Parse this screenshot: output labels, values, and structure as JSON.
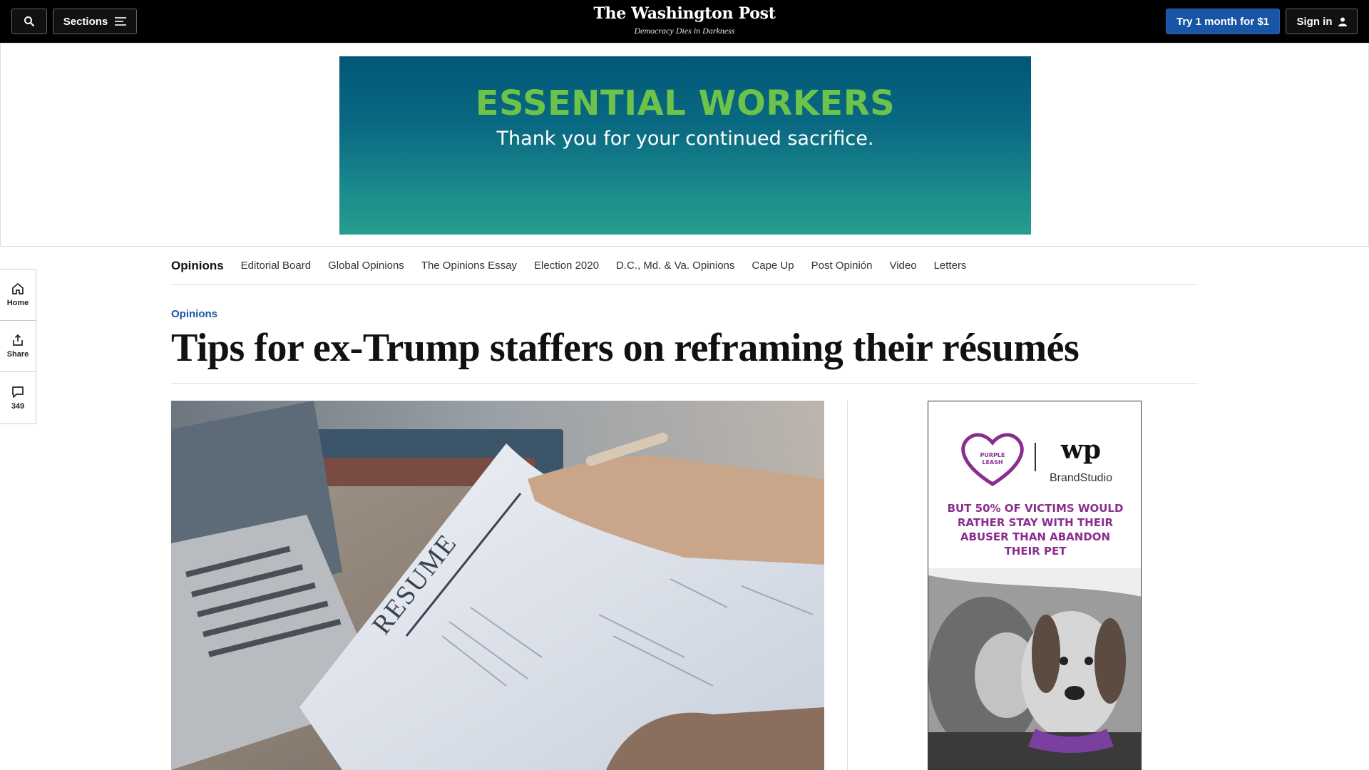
{
  "header": {
    "search_icon": "search-icon",
    "sections_label": "Sections",
    "logo_name": "The Washington Post",
    "logo_tagline": "Democracy Dies in Darkness",
    "try_label": "Try 1 month for $1",
    "signin_label": "Sign in",
    "colors": {
      "bar": "#000000",
      "accent": "#1955a5"
    }
  },
  "top_ad": {
    "headline": "ESSENTIAL WORKERS",
    "subline": "Thank you for your continued sacrifice.",
    "colors": {
      "headline": "#6dc34a",
      "bg_top": "#015777",
      "bg_bottom": "#279d8e"
    }
  },
  "rail": {
    "items": [
      {
        "icon": "home-icon",
        "label": "Home"
      },
      {
        "icon": "share-icon",
        "label": "Share"
      },
      {
        "icon": "comment-icon",
        "label": "349"
      }
    ]
  },
  "subnav": {
    "items": [
      "Opinions",
      "Editorial Board",
      "Global Opinions",
      "The Opinions Essay",
      "Election 2020",
      "D.C., Md. & Va. Opinions",
      "Cape Up",
      "Post Opinión",
      "Video",
      "Letters"
    ]
  },
  "article": {
    "kicker": "Opinions",
    "headline": "Tips for ex-Trump staffers on reframing their résumés",
    "image_text": "RESUME"
  },
  "side_ad": {
    "brand_left": "PURPLE LEASH PROJECT",
    "brand_right_mark": "wp",
    "brand_right_name": "BrandStudio",
    "text": "BUT 50% OF VICTIMS WOULD RATHER STAY WITH THEIR ABUSER THAN ABANDON THEIR PET",
    "color": "#8a2e8e"
  }
}
